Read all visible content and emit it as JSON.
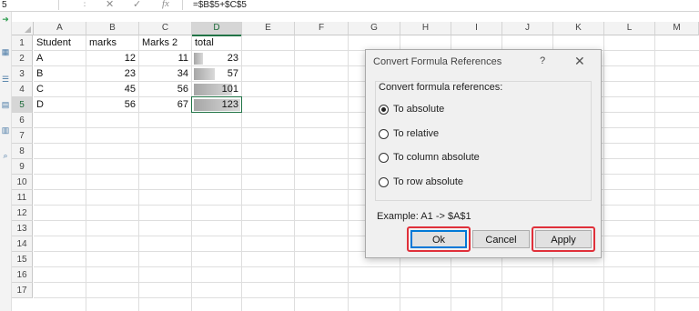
{
  "formula_bar": {
    "name_box": "5",
    "cancel_icon": "✕",
    "enter_icon": "✓",
    "fx_icon": "fx",
    "formula": "=$B$5+$C$5"
  },
  "columns": [
    "A",
    "B",
    "C",
    "D",
    "E",
    "F",
    "G",
    "H",
    "I",
    "J",
    "K",
    "L",
    "M"
  ],
  "rows": [
    "1",
    "2",
    "3",
    "4",
    "5",
    "6",
    "7",
    "8",
    "9",
    "10",
    "11",
    "12",
    "13",
    "14",
    "15",
    "16",
    "17"
  ],
  "sheet": {
    "headers": [
      "Student",
      "marks",
      "Marks 2",
      "total"
    ],
    "data": [
      [
        "A",
        "12",
        "11",
        "23"
      ],
      [
        "B",
        "23",
        "34",
        "57"
      ],
      [
        "C",
        "45",
        "56",
        "101"
      ],
      [
        "D",
        "56",
        "67",
        "123"
      ]
    ],
    "databar_fraction": [
      0.19,
      0.46,
      0.82,
      1.0
    ],
    "databar_color": "#a6a6a6"
  },
  "dialog": {
    "title": "Convert Formula References",
    "help": "?",
    "close": "✕",
    "group_label": "Convert formula references:",
    "options": [
      "To absolute",
      "To relative",
      "To column absolute",
      "To row absolute"
    ],
    "selected_index": 0,
    "example": "Example: A1 -> $A$1",
    "ok_label": "Ok",
    "cancel_label": "Cancel",
    "apply_label": "Apply",
    "highlight_color": "#e0303a"
  }
}
